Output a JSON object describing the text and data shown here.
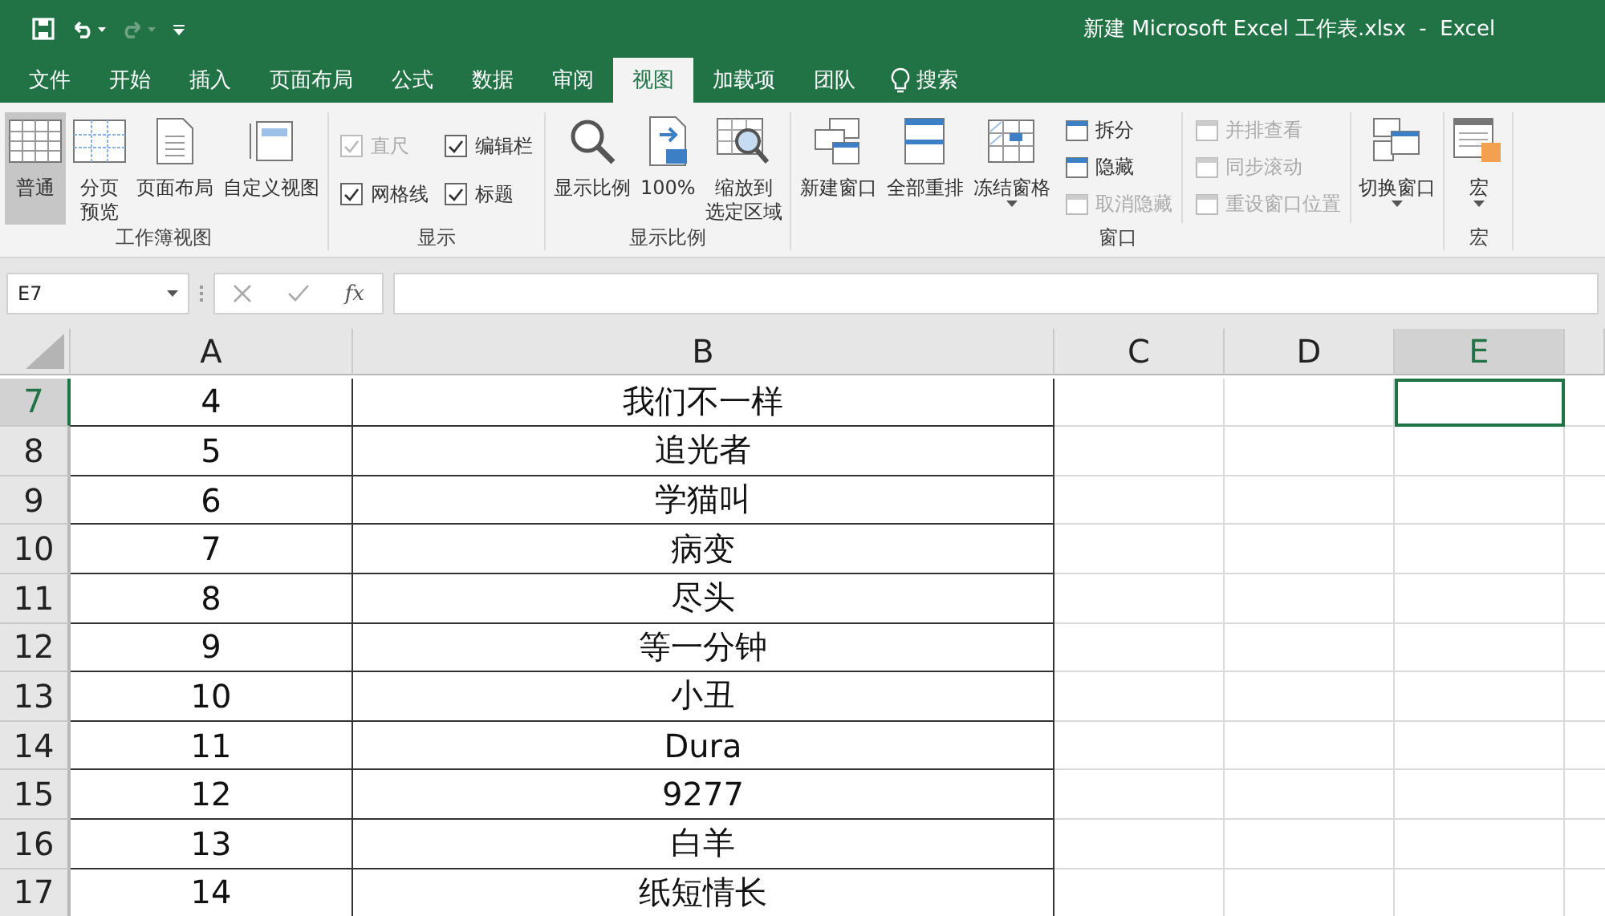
{
  "window": {
    "title": "新建 Microsoft Excel 工作表.xlsx  -  Excel"
  },
  "menu_tabs": [
    {
      "label": "文件",
      "selected": false
    },
    {
      "label": "开始",
      "selected": false
    },
    {
      "label": "插入",
      "selected": false
    },
    {
      "label": "页面布局",
      "selected": false
    },
    {
      "label": "公式",
      "selected": false
    },
    {
      "label": "数据",
      "selected": false
    },
    {
      "label": "审阅",
      "selected": false
    },
    {
      "label": "视图",
      "selected": true
    },
    {
      "label": "加载项",
      "selected": false
    },
    {
      "label": "团队",
      "selected": false
    }
  ],
  "search": {
    "label": "搜索"
  },
  "ribbon_groups": [
    {
      "label": "工作簿视图",
      "items": [
        {
          "kind": "large",
          "label": "普通",
          "selected": true
        },
        {
          "kind": "large",
          "lines": [
            "分页",
            "预览"
          ],
          "selected": false
        },
        {
          "kind": "large",
          "label": "页面布局",
          "selected": false
        },
        {
          "kind": "large",
          "label": "自定义视图",
          "selected": false
        }
      ]
    },
    {
      "label": "显示",
      "items": [
        {
          "kind": "check",
          "label": "直尺",
          "checked": true,
          "disabled": true
        },
        {
          "kind": "check",
          "label": "网格线",
          "checked": true,
          "disabled": false
        },
        {
          "kind": "check",
          "label": "编辑栏",
          "checked": true,
          "disabled": false
        },
        {
          "kind": "check",
          "label": "标题",
          "checked": true,
          "disabled": false
        }
      ]
    },
    {
      "label": "显示比例",
      "items": [
        {
          "kind": "large",
          "label": "显示比例",
          "selected": false
        },
        {
          "kind": "large",
          "label": "100%",
          "selected": false
        },
        {
          "kind": "large",
          "lines": [
            "缩放到",
            "选定区域"
          ],
          "selected": false
        }
      ]
    },
    {
      "label": "窗口",
      "items": [
        {
          "kind": "large",
          "label": "新建窗口",
          "selected": false
        },
        {
          "kind": "large",
          "label": "全部重排",
          "selected": false
        },
        {
          "kind": "large",
          "label": "冻结窗格",
          "selected": false,
          "dropdown": true
        },
        {
          "kind": "small",
          "label": "拆分",
          "disabled": false
        },
        {
          "kind": "small",
          "label": "隐藏",
          "disabled": false
        },
        {
          "kind": "small",
          "label": "取消隐藏",
          "disabled": true
        },
        {
          "kind": "small",
          "label": "并排查看",
          "disabled": true
        },
        {
          "kind": "small",
          "label": "同步滚动",
          "disabled": true
        },
        {
          "kind": "small",
          "label": "重设窗口位置",
          "disabled": true
        },
        {
          "kind": "large",
          "label": "切换窗口",
          "selected": false,
          "dropdown": true
        }
      ]
    },
    {
      "label": "宏",
      "items": [
        {
          "kind": "large",
          "label": "宏",
          "selected": false,
          "dropdown": true
        }
      ]
    }
  ],
  "formula_bar": {
    "name_box": "E7",
    "function_label": "fx"
  },
  "sheet": {
    "columns": [
      {
        "label": "A",
        "selected": false
      },
      {
        "label": "B",
        "selected": false
      },
      {
        "label": "C",
        "selected": false
      },
      {
        "label": "D",
        "selected": false
      },
      {
        "label": "E",
        "selected": true
      }
    ],
    "rows": [
      {
        "header": "7",
        "selected": true,
        "cells": [
          "4",
          "我们不一样",
          "",
          "",
          ""
        ]
      },
      {
        "header": "8",
        "selected": false,
        "cells": [
          "5",
          "追光者",
          "",
          "",
          ""
        ]
      },
      {
        "header": "9",
        "selected": false,
        "cells": [
          "6",
          "学猫叫",
          "",
          "",
          ""
        ]
      },
      {
        "header": "10",
        "selected": false,
        "cells": [
          "7",
          "病变",
          "",
          "",
          ""
        ]
      },
      {
        "header": "11",
        "selected": false,
        "cells": [
          "8",
          "尽头",
          "",
          "",
          ""
        ]
      },
      {
        "header": "12",
        "selected": false,
        "cells": [
          "9",
          "等一分钟",
          "",
          "",
          ""
        ]
      },
      {
        "header": "13",
        "selected": false,
        "cells": [
          "10",
          "小丑",
          "",
          "",
          ""
        ]
      },
      {
        "header": "14",
        "selected": false,
        "cells": [
          "11",
          "Dura",
          "",
          "",
          ""
        ]
      },
      {
        "header": "15",
        "selected": false,
        "cells": [
          "12",
          "9277",
          "",
          "",
          ""
        ]
      },
      {
        "header": "16",
        "selected": false,
        "cells": [
          "13",
          "白羊",
          "",
          "",
          ""
        ]
      },
      {
        "header": "17",
        "selected": false,
        "cells": [
          "14",
          "纸短情长",
          "",
          "",
          ""
        ]
      }
    ]
  }
}
